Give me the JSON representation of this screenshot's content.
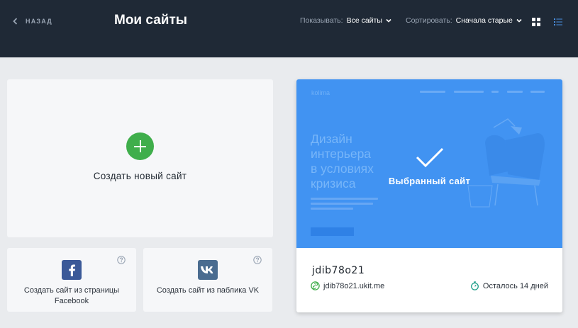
{
  "header": {
    "back_label": "НАЗАД",
    "title": "Мои сайты",
    "filter_show": {
      "label": "Показывать:",
      "value": "Все сайты"
    },
    "filter_sort": {
      "label": "Сортировать:",
      "value": "Сначала старые"
    },
    "view_modes": [
      "grid-icon",
      "list-icon"
    ]
  },
  "create_card": {
    "label": "Создать новый сайт",
    "icon": "plus-circle-icon"
  },
  "social_cards": [
    {
      "label": "Создать сайт из страницы Facebook",
      "icon": "facebook-icon"
    },
    {
      "label": "Создать сайт из паблика VK",
      "icon": "vk-icon"
    }
  ],
  "site": {
    "name": "jdib78o21",
    "url": "jdib78o21.ukit.me",
    "time_left": "Осталось 14 дней",
    "selected_label": "Выбранный сайт",
    "preview": {
      "logo": "kolima",
      "headline": [
        "Дизайн",
        "интерьера",
        "в условиях",
        "кризиса"
      ]
    }
  },
  "colors": {
    "header_bg": "#1f2936",
    "page_bg": "#e9ebee",
    "accent_green": "#3fae4b",
    "preview_blue": "#4193f2",
    "facebook": "#3b5998",
    "vk": "#4a6c90"
  }
}
